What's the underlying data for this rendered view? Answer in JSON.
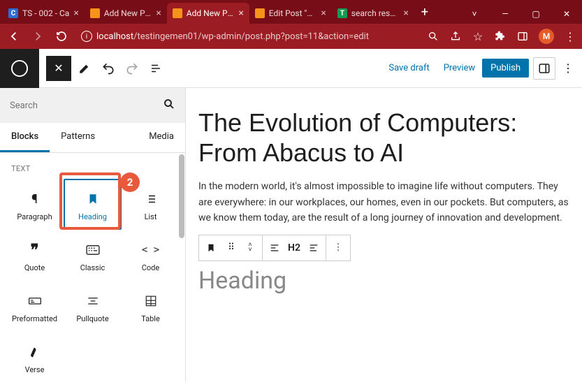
{
  "browser": {
    "tabs": [
      {
        "label": "TS - 002 - Ca",
        "favicon": "fav-blue",
        "ficon": "C"
      },
      {
        "label": "Add New Pos",
        "favicon": "fav-orange",
        "ficon": ""
      },
      {
        "label": "Add New Pos",
        "favicon": "fav-orange",
        "ficon": "",
        "active": true
      },
      {
        "label": "Edit Post \"The",
        "favicon": "fav-orange",
        "ficon": ""
      },
      {
        "label": "search result",
        "favicon": "fav-green",
        "ficon": "T"
      }
    ],
    "url_host": "localhost",
    "url_path": "/testingemen01/wp-admin/post.php?post=11&action=edit",
    "avatar_letter": "M"
  },
  "topbar": {
    "save_draft": "Save draft",
    "preview": "Preview",
    "publish": "Publish"
  },
  "sidebar": {
    "search_placeholder": "Search",
    "tabs": [
      "Blocks",
      "Patterns",
      "Media"
    ],
    "active_tab": 0,
    "section_label": "TEXT",
    "blocks": [
      {
        "label": "Paragraph",
        "icon": "¶"
      },
      {
        "label": "Heading",
        "icon": "🔖",
        "selected": true
      },
      {
        "label": "List",
        "icon": "≔"
      },
      {
        "label": "Quote",
        "icon": "❞"
      },
      {
        "label": "Classic",
        "icon": "⌨"
      },
      {
        "label": "Code",
        "icon": "< >"
      },
      {
        "label": "Preformatted",
        "icon": "▭"
      },
      {
        "label": "Pullquote",
        "icon": "⎯"
      },
      {
        "label": "Table",
        "icon": "▦"
      },
      {
        "label": "Verse",
        "icon": "✒"
      }
    ],
    "annotation_number": "2"
  },
  "editor": {
    "title": "The Evolution of Computers: From Abacus to AI",
    "paragraph": "In the modern world, it's almost impossible to imagine life without computers. They are everywhere: in our workplaces, our homes, even in our pockets. But computers, as we know them today, are the result of a long journey of innovation and development.",
    "toolbar": {
      "level": "H2"
    },
    "heading_placeholder": "Heading"
  }
}
